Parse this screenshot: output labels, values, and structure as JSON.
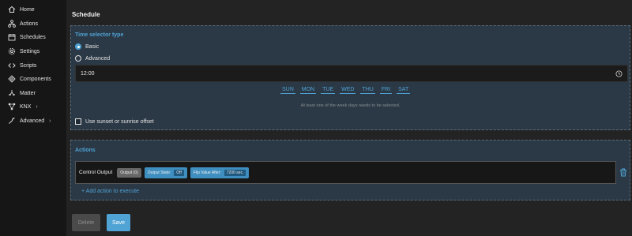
{
  "sidebar": {
    "items": [
      {
        "label": "Home",
        "icon": "home-icon"
      },
      {
        "label": "Actions",
        "icon": "actions-icon"
      },
      {
        "label": "Schedules",
        "icon": "calendar-icon"
      },
      {
        "label": "Settings",
        "icon": "gear-icon"
      },
      {
        "label": "Scripts",
        "icon": "code-icon"
      },
      {
        "label": "Components",
        "icon": "components-icon"
      },
      {
        "label": "Matter",
        "icon": "matter-icon"
      },
      {
        "label": "KNX",
        "icon": "knx-icon",
        "chevron": "›"
      },
      {
        "label": "Advanced",
        "icon": "wrench-icon",
        "chevron": "›"
      }
    ]
  },
  "page": {
    "title": "Schedule"
  },
  "time_selector": {
    "title": "Time selector type",
    "options": [
      {
        "label": "Basic",
        "selected": true
      },
      {
        "label": "Advanced",
        "selected": false
      }
    ],
    "time_value": "12:00",
    "days": [
      "SUN",
      "MON",
      "TUE",
      "WED",
      "THU",
      "FRI",
      "SAT"
    ],
    "hint": "At least one of the week days needs to be selected.",
    "sunset_label": "Use sunset or sunrise offset",
    "sunset_checked": false
  },
  "actions": {
    "title": "Actions",
    "items": [
      {
        "name": "Control Output",
        "output_chip": "Output (0)",
        "state_label": "Output State:",
        "state_value": "Off",
        "flip_label": "Flip Value After:",
        "flip_value": "7200 sec."
      }
    ],
    "add_label": "+ Add action to execute"
  },
  "buttons": {
    "delete": "Delete",
    "save": "Save"
  },
  "colors": {
    "accent": "#4fa3d5",
    "panel_bg": "#2b3845",
    "sidebar_bg": "#161616",
    "page_bg": "#232323"
  }
}
